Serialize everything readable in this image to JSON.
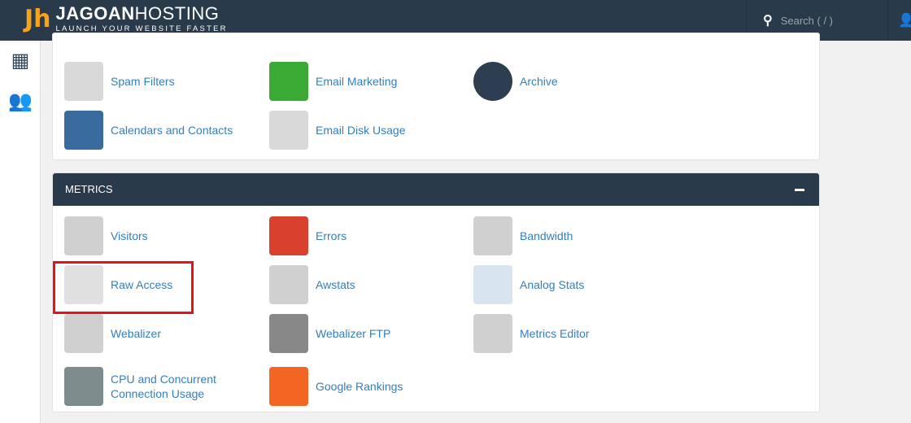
{
  "header": {
    "brand_bold": "JAGOAN",
    "brand_light": "HOSTING",
    "tagline": "LAUNCH YOUR WEBSITE FASTER",
    "search_placeholder": "Search ( / )"
  },
  "email_items": [
    {
      "label": "Spam Filters",
      "icon": "envelope-feather-icon",
      "color": "#d9d9d9"
    },
    {
      "label": "Email Marketing",
      "icon": "envelope-dollar-icon",
      "color": "#3aaa35"
    },
    {
      "label": "Archive",
      "icon": "archive-envelope-icon",
      "color": "#2c3e50"
    },
    {
      "label": "Calendars and Contacts",
      "icon": "calendar-icon",
      "color": "#3a6b9f"
    },
    {
      "label": "Email Disk Usage",
      "icon": "envelope-pie-icon",
      "color": "#d9d9d9"
    }
  ],
  "metrics": {
    "title": "METRICS",
    "items": [
      {
        "label": "Visitors",
        "icon": "visitors-icon",
        "color": "#d0d0d0"
      },
      {
        "label": "Errors",
        "icon": "error-icon",
        "color": "#d9402e"
      },
      {
        "label": "Bandwidth",
        "icon": "gauge-icon",
        "color": "#d0d0d0"
      },
      {
        "label": "Raw Access",
        "icon": "document-download-icon",
        "color": "#e0e0e0"
      },
      {
        "label": "Awstats",
        "icon": "line-chart-icon",
        "color": "#d0d0d0"
      },
      {
        "label": "Analog Stats",
        "icon": "numbers-icon",
        "color": "#d8e4ef"
      },
      {
        "label": "Webalizer",
        "icon": "waveform-icon",
        "color": "#d0d0d0"
      },
      {
        "label": "Webalizer FTP",
        "icon": "truck-icon",
        "color": "#888888"
      },
      {
        "label": "Metrics Editor",
        "icon": "metrics-editor-icon",
        "color": "#d0d0d0"
      },
      {
        "label": "CPU and Concurrent Connection Usage",
        "icon": "cpu-gauge-icon",
        "color": "#7f8c8d"
      },
      {
        "label": "Google Rankings",
        "icon": "rankings-icon",
        "color": "#f26522"
      }
    ]
  }
}
